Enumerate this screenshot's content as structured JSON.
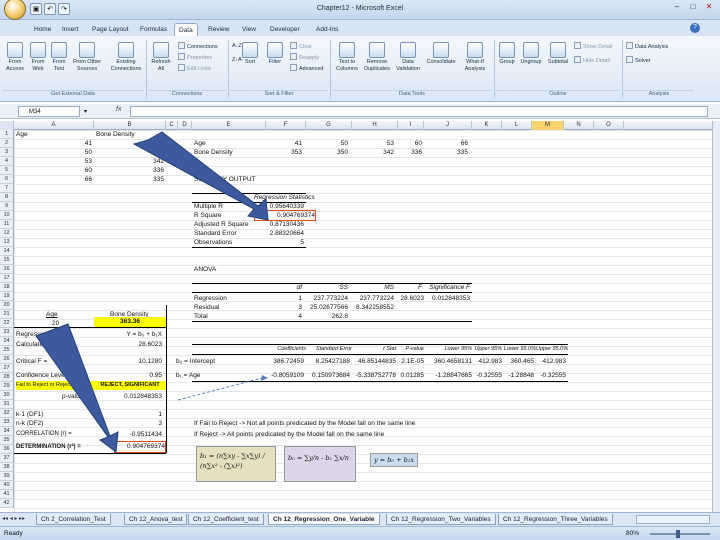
{
  "window": {
    "title": "Chapter12 - Microsoft Excel"
  },
  "tabs": [
    "Home",
    "Insert",
    "Page Layout",
    "Formulas",
    "Data",
    "Review",
    "View",
    "Developer",
    "Add-Ins"
  ],
  "active_tab": "Data",
  "ribbon": {
    "from_access": "From Access",
    "from_web": "From Web",
    "from_text": "From Text",
    "from_other": "From Other Sources",
    "existing": "Existing Connections",
    "refresh": "Refresh All",
    "connections": "Connections",
    "properties": "Properties",
    "edit_links": "Edit Links",
    "sort_az": "A↓Z",
    "sort_za": "Z↓A",
    "sort": "Sort",
    "filter": "Filter",
    "clear": "Clear",
    "reapply": "Reapply",
    "advanced": "Advanced",
    "text_to_columns": "Text to Columns",
    "remove_dup": "Remove Duplicates",
    "data_validation": "Data Validation",
    "consolidate": "Consolidate",
    "whatif": "What-If Analysis",
    "group": "Group",
    "ungroup": "Ungroup",
    "subtotal": "Subtotal",
    "show_detail": "Show Detail",
    "hide_detail": "Hide Detail",
    "data_analysis": "Data Analysis",
    "solver": "Solver",
    "groups": {
      "get_external": "Get External Data",
      "connections": "Connections",
      "sort_filter": "Sort & Filter",
      "data_tools": "Data Tools",
      "outline": "Outline",
      "analysis": "Analysis"
    }
  },
  "formula_bar": {
    "name_box": "M34",
    "fx": "fx"
  },
  "columns": [
    "A",
    "B",
    "C",
    "D",
    "E",
    "F",
    "G",
    "H",
    "I",
    "J",
    "K",
    "L",
    "M",
    "N",
    "O"
  ],
  "rows": [
    "1",
    "2",
    "3",
    "4",
    "5",
    "6",
    "7",
    "8",
    "9",
    "10",
    "11",
    "12",
    "13",
    "14",
    "15",
    "16",
    "17",
    "18",
    "19",
    "20",
    "21",
    "22",
    "23",
    "24",
    "25",
    "26",
    "27",
    "28",
    "29",
    "30",
    "31",
    "32",
    "33",
    "34",
    "35",
    "36",
    "37",
    "38",
    "39",
    "40",
    "41",
    "42"
  ],
  "data_left": {
    "h_age": "Age",
    "h_bd": "Bone Density",
    "ages": [
      "41",
      "50",
      "53",
      "60",
      "66"
    ],
    "bds": [
      "351",
      "350",
      "342",
      "336",
      "335"
    ]
  },
  "data_top": {
    "age_label": "Age",
    "bd_label": "Bone Density",
    "ages": [
      "41",
      "50",
      "53",
      "60",
      "66"
    ],
    "bds": [
      "353",
      "350",
      "342",
      "336",
      "335"
    ]
  },
  "summary": {
    "title": "SUMMARY OUTPUT",
    "reg_stats": "Regression Statistics",
    "labels": [
      "Multiple R",
      "R Square",
      "Adjusted R Square",
      "Standard Error",
      "Observations"
    ],
    "values": [
      "0.95640339",
      "0.904769374",
      "0.87130436",
      "2.88320664",
      "5"
    ],
    "anova": "ANOVA",
    "anova_hdr": [
      "df",
      "SS",
      "MS",
      "F",
      "Significance F"
    ],
    "anova_rows": [
      {
        "label": "Regression",
        "df": "1",
        "ss": "237.773224",
        "ms": "237.773224",
        "f": "28.6023",
        "sigf": "0.012848353"
      },
      {
        "label": "Residual",
        "df": "3",
        "ss": "25.02677566",
        "ms": "8.342258552",
        "f": "",
        "sigf": ""
      },
      {
        "label": "Total",
        "df": "4",
        "ss": "262.8",
        "ms": "",
        "f": "",
        "sigf": ""
      }
    ],
    "coef_hdr": [
      "Coefficients",
      "Standard Error",
      "t Stat",
      "P-value",
      "Lower 95%",
      "Upper 95%",
      "Lower 95.0%",
      "Upper 95.0%"
    ],
    "coef_rows": [
      {
        "label": "b₀ = Intercept",
        "v": [
          "386.72459",
          "8.25427188",
          "46.85144835",
          "2.1E-05",
          "360.4658131",
          "412.983",
          "360.465",
          "412.983"
        ]
      },
      {
        "label": "b₁ = Age",
        "v": [
          "-0.8059109",
          "0.150973684",
          "-5.338752778",
          "0.01285",
          "-1.28847665",
          "-0.32555",
          "-1.28848",
          "-0.32555"
        ]
      }
    ]
  },
  "calc": {
    "age_lbl": "Age",
    "bd_lbl": "Bone Density",
    "age_val": "20",
    "bd_val": "363.36",
    "regression_lbl": "Regression =",
    "regression_val": "Y = b₀ + b₁X",
    "tcalc_lbl": "Calculated F =",
    "tcalc_val": "28.6023",
    "crit_lbl": "Critical F =",
    "crit_val": "10.1280",
    "conf_lbl": "Confidence Level =",
    "conf_val": "0.95",
    "reject_lbl": "Fail to Reject or Reject",
    "reject_val": "REJECT, SIGNIFICANT",
    "p_lbl": "p-value =",
    "p_val": "0.012848353",
    "df1_lbl": "k-1 (DF1)",
    "df1_val": "1",
    "df2_lbl": "n-k (DF2)",
    "df2_val": "3",
    "corr_lbl": "CORRELATION (r) =",
    "corr_val": "-0.9511434",
    "det_lbl": "DETERMINATION (r²) =",
    "det_val": "0.904769374"
  },
  "notes": {
    "fail": "If Fail to Reject -> Not all points predicated by the Model fall on the same line",
    "reject": "If Reject -> All points predicated by the Model fall on the same line"
  },
  "formulas": {
    "b1": "b₁ = (n∑xy - ∑x∑y) / (n∑x² - (∑x)²)",
    "b0": "b₀ = ∑y/n - b₁ ∑x/n",
    "yhat": "y = b₀ + b₁x"
  },
  "sheets": [
    "Ch 2_Correlation_Test",
    "Ch 12_Anova_test",
    "Ch 12_Coefficient_test",
    "Ch 12_Regression_One_Variable",
    "Ch 12_Regression_Two_Variables",
    "Ch 12_Regression_Three_Variables"
  ],
  "active_sheet": "Ch 12_Regression_One_Variable",
  "status": {
    "left": "Ready",
    "zoom": "80%"
  },
  "colors": {
    "highlight": "#ffff00",
    "arrow": "#3d5a9e",
    "box": "#e04a1a"
  }
}
